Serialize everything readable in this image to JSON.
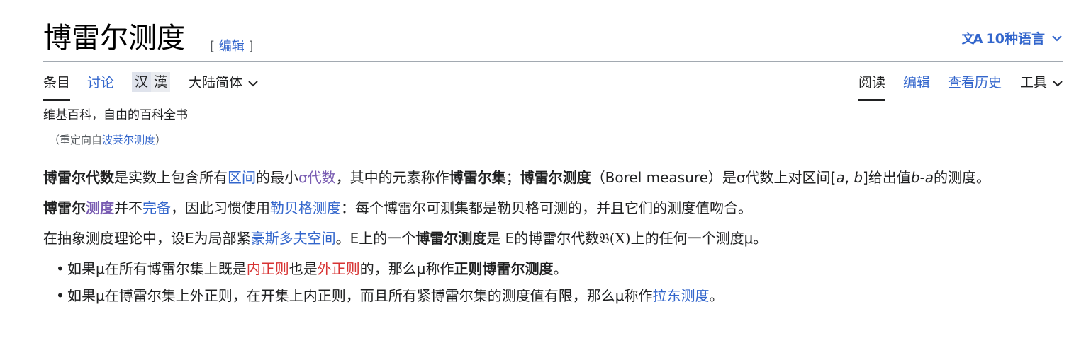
{
  "header": {
    "title": "博雷尔测度",
    "edit_open": "[",
    "edit_label": "编辑",
    "edit_close": "]",
    "lang_icon": "文A",
    "lang_label": "10种语言",
    "lang_chevron": "chevron-down-icon"
  },
  "tabs": {
    "article": "条目",
    "talk": "讨论",
    "simplified": "汉",
    "traditional": "漢",
    "variant": "大陆简体",
    "read": "阅读",
    "edit": "编辑",
    "history": "查看历史",
    "tools": "工具"
  },
  "tagline": "维基百科，自由的百科全书",
  "redirect": {
    "open": "（重定向自",
    "link": "波莱尔测度",
    "close": "）"
  },
  "paragraphs": {
    "p1": {
      "b1": "博雷尔代数",
      "t1": "是实数上包含所有",
      "l1": "区间",
      "t2": "的最小",
      "l2": "σ代数",
      "t3": "，其中的元素称作",
      "b2": "博雷尔集",
      "t4": "；",
      "b3": "博雷尔测度",
      "t5": "（Borel measure）是σ代数上对区间[",
      "a": "a",
      "comma": ", ",
      "b": "b",
      "t6": "]给出值",
      "b_minus": "b",
      "dash": "-",
      "a2": "a",
      "t7": "的测度。"
    },
    "p2": {
      "b1": "博雷尔",
      "l1": "测度",
      "t1": "并不",
      "l2": "完备",
      "t2": "，因此习惯使用",
      "l3": "勒贝格测度",
      "t3": "：每个博雷尔可测集都是勒贝格可测的，并且它们的测度值吻合。"
    },
    "p3": {
      "t1": "在抽象测度理论中，设E为局部紧",
      "l1": "豪斯多夫空间",
      "t2": "。E上的一个",
      "b1": "博雷尔测度",
      "t3": "是 E的博雷尔代数",
      "math": "𝔅(X)",
      "t4": "上的任何一个测度μ。"
    },
    "list": {
      "i1_t1": "如果μ在所有博雷尔集上既是",
      "i1_l1": "内正则",
      "i1_t2": "也是",
      "i1_l2": "外正则",
      "i1_t3": "的，那么μ称作",
      "i1_b1": "正则博雷尔测度",
      "i1_t4": "。",
      "i2_t1": "如果μ在博雷尔集上外正则，在开集上内正则，而且所有紧博雷尔集的测度值有限，那么μ称作",
      "i2_l1": "拉东测度",
      "i2_t2": "。"
    }
  },
  "colors": {
    "link": "#3366cc",
    "visited": "#795cb2",
    "redlink": "#d73333",
    "text": "#202122"
  }
}
